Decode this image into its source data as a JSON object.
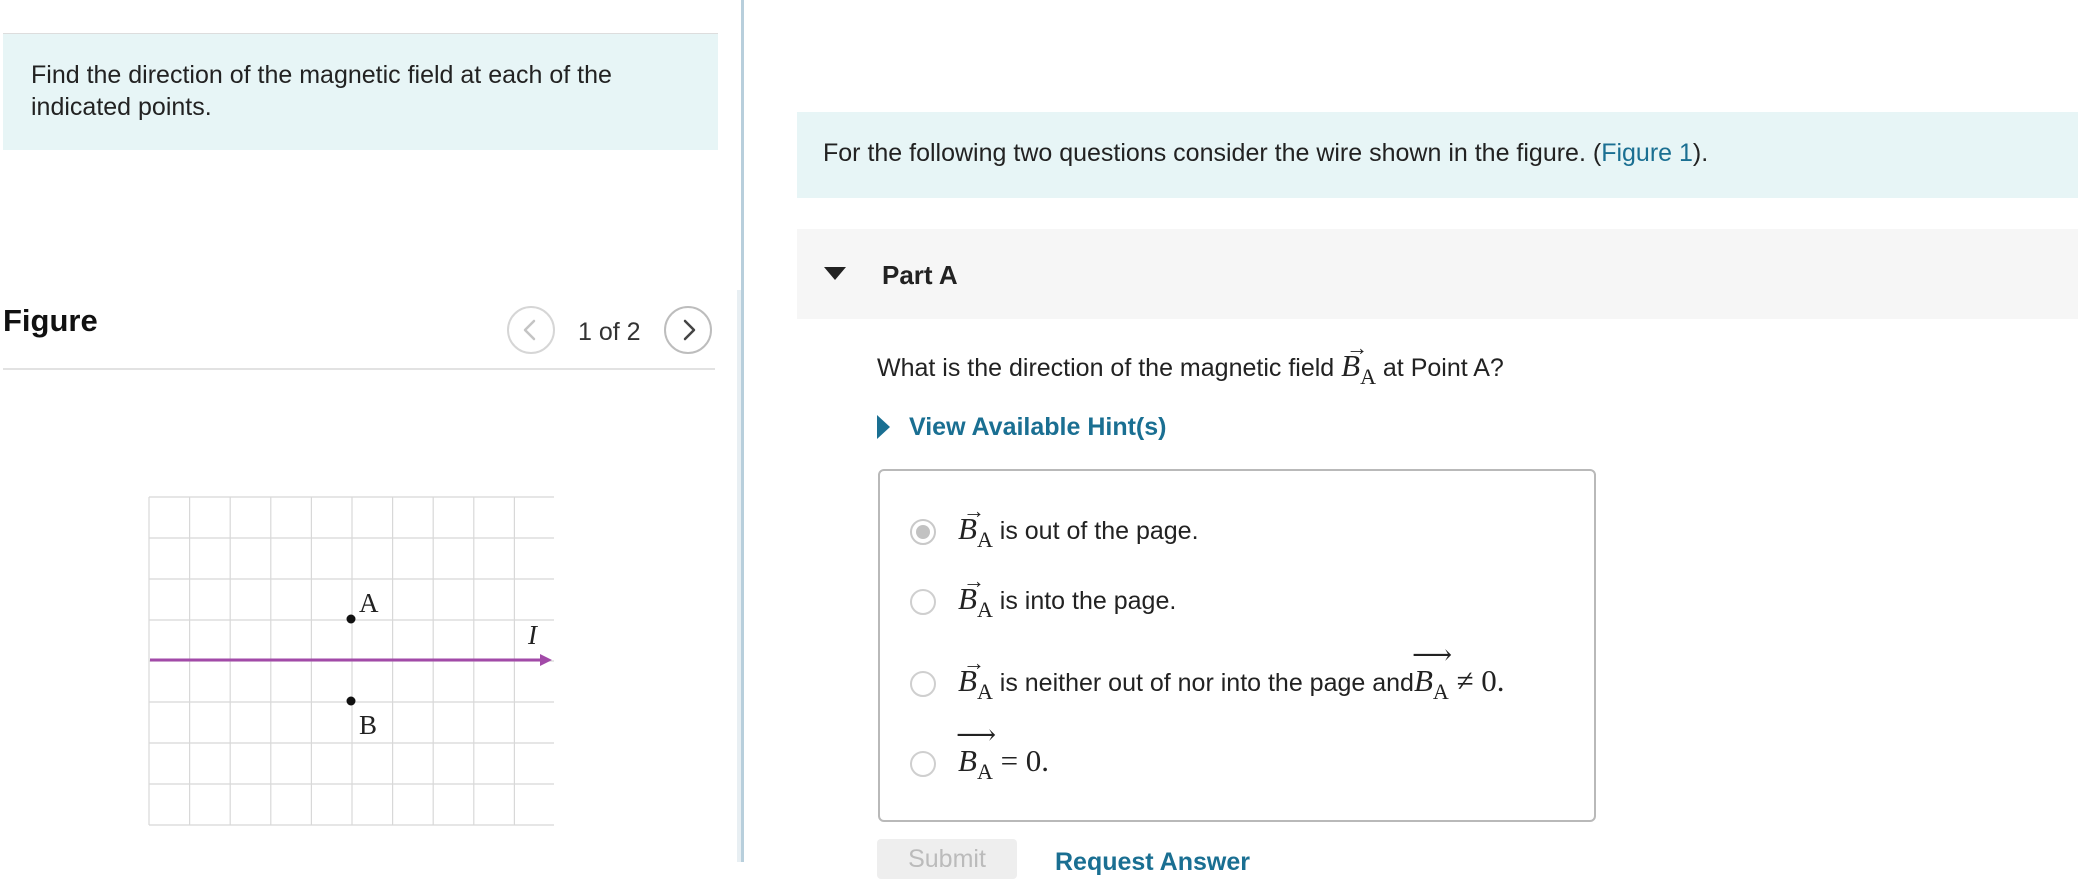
{
  "intro": {
    "text": "Find the direction of the magnetic field at each of the indicated points."
  },
  "figure_panel": {
    "title": "Figure",
    "counter": "1 of 2",
    "prev_icon": "chevron-left-icon",
    "next_icon": "chevron-right-icon",
    "figure": {
      "point_a_label": "A",
      "point_b_label": "B",
      "current_label": "I",
      "wire_color": "#a24aa8",
      "grid_color": "#d8d8d8"
    }
  },
  "context": {
    "text_before": "For the following two questions consider the wire shown in the figure. (",
    "link": "Figure 1",
    "text_after": ")."
  },
  "part": {
    "title": "Part A",
    "caret_icon": "caret-down-icon"
  },
  "question": {
    "before": "What is the direction of the magnetic field ",
    "symbol": "B",
    "subscript": "A",
    "after": " at Point A?"
  },
  "hints": {
    "label": "View Available Hint(s)",
    "caret_icon": "caret-right-icon"
  },
  "choices": [
    {
      "symbol": "B",
      "subscript": "A",
      "text": " is out of the page.",
      "selected": true
    },
    {
      "symbol": "B",
      "subscript": "A",
      "text": " is into the page.",
      "selected": false
    },
    {
      "symbol": "B",
      "subscript": "A",
      "text": " is neither out of nor into the page and",
      "math_tail_symbol": "B",
      "math_tail_subscript": "A",
      "math_tail_rel": " ≠ 0.",
      "selected": false
    },
    {
      "symbol": "B",
      "subscript": "A",
      "math_rel": " = 0.",
      "selected": false
    }
  ],
  "actions": {
    "submit": "Submit",
    "request_answer": "Request Answer"
  },
  "colors": {
    "accent_link": "#1a6f92",
    "info_background": "#e7f5f6",
    "part_header_background": "#f6f6f6"
  }
}
